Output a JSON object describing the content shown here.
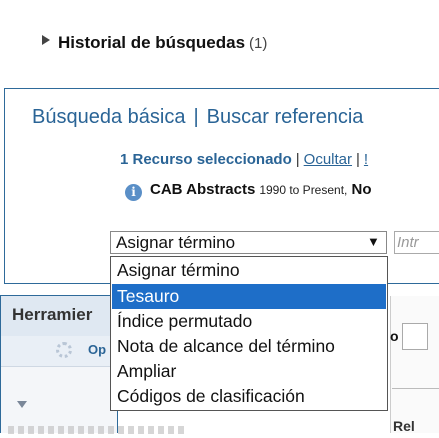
{
  "history": {
    "title": "Historial de búsquedas",
    "count": "(1)"
  },
  "search": {
    "tabs": [
      "Búsqueda básica",
      "Buscar referencia"
    ],
    "tab_separator": "|",
    "resources_label": "1 Recurso seleccionado",
    "separator": "|",
    "hide_link": "Ocultar",
    "more_link": "!",
    "database": {
      "name": "CAB Abstracts",
      "range": "1990 to Present,",
      "more": "No"
    },
    "field_select": {
      "value": "Asignar término",
      "options": [
        "Asignar término",
        "Tesauro",
        "Índice permutado",
        "Nota de alcance del término",
        "Ampliar",
        "Códigos de clasificación"
      ],
      "highlighted_index": 1
    },
    "term_input_placeholder": "Intr"
  },
  "tools": {
    "title": "Herramier",
    "options_label": "Op"
  },
  "right_panel": {
    "stub_o": "o",
    "stub_rel": "Rel"
  },
  "colors": {
    "link_blue": "#2a6496",
    "highlight": "#1e6ec8",
    "panel_border": "#2e6a9a"
  }
}
